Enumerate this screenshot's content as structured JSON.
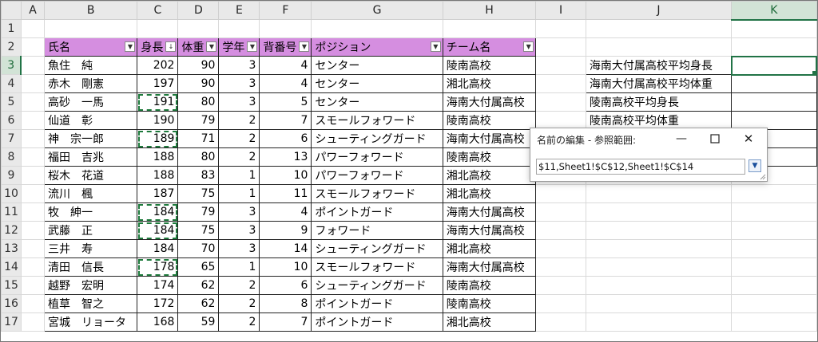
{
  "columns": [
    "A",
    "B",
    "C",
    "D",
    "E",
    "F",
    "G",
    "H",
    "I",
    "J",
    "K"
  ],
  "rows": [
    "1",
    "2",
    "3",
    "4",
    "5",
    "6",
    "7",
    "8",
    "9",
    "10",
    "11",
    "12",
    "13",
    "14",
    "15",
    "16",
    "17"
  ],
  "headers": [
    "氏名",
    "身長",
    "体重",
    "学年",
    "背番号",
    "ポジション",
    "チーム名"
  ],
  "table": [
    [
      "魚住　純",
      "202",
      "90",
      "3",
      "4",
      "センター",
      "陵南高校"
    ],
    [
      "赤木　剛憲",
      "197",
      "90",
      "3",
      "4",
      "センター",
      "湘北高校"
    ],
    [
      "高砂　一馬",
      "191",
      "80",
      "3",
      "5",
      "センター",
      "海南大付属高校"
    ],
    [
      "仙道　彰",
      "190",
      "79",
      "2",
      "7",
      "スモールフォワード",
      "陵南高校"
    ],
    [
      "神　宗一郎",
      "189",
      "71",
      "2",
      "6",
      "シューティングガード",
      "海南大付属高校"
    ],
    [
      "福田　吉兆",
      "188",
      "80",
      "2",
      "13",
      "パワーフォワード",
      "陵南高校"
    ],
    [
      "桜木　花道",
      "188",
      "83",
      "1",
      "10",
      "パワーフォワード",
      "湘北高校"
    ],
    [
      "流川　楓",
      "187",
      "75",
      "1",
      "11",
      "スモールフォワード",
      "湘北高校"
    ],
    [
      "牧　紳一",
      "184",
      "79",
      "3",
      "4",
      "ポイントガード",
      "海南大付属高校"
    ],
    [
      "武藤　正",
      "184",
      "75",
      "3",
      "9",
      "フォワード",
      "海南大付属高校"
    ],
    [
      "三井　寿",
      "184",
      "70",
      "3",
      "14",
      "シューティングガード",
      "湘北高校"
    ],
    [
      "清田　信長",
      "178",
      "65",
      "1",
      "10",
      "スモールフォワード",
      "海南大付属高校"
    ],
    [
      "越野　宏明",
      "174",
      "62",
      "2",
      "6",
      "シューティングガード",
      "陵南高校"
    ],
    [
      "植草　智之",
      "172",
      "62",
      "2",
      "8",
      "ポイントガード",
      "陵南高校"
    ],
    [
      "宮城　リョータ",
      "168",
      "59",
      "2",
      "7",
      "ポイントガード",
      "湘北高校"
    ]
  ],
  "summary_labels": [
    "海南大付属高校平均身長",
    "海南大付属高校平均体重",
    "陵南高校平均身長",
    "陵南高校平均体重"
  ],
  "dialog": {
    "title": "名前の編集 - 参照範囲:",
    "min": "—",
    "max": "☐",
    "close": "✕",
    "value": "$11,Sheet1!$C$12,Sheet1!$C$14",
    "collapse_icon": "▼"
  },
  "filter_icon": "▼",
  "sort_icon": "↓"
}
